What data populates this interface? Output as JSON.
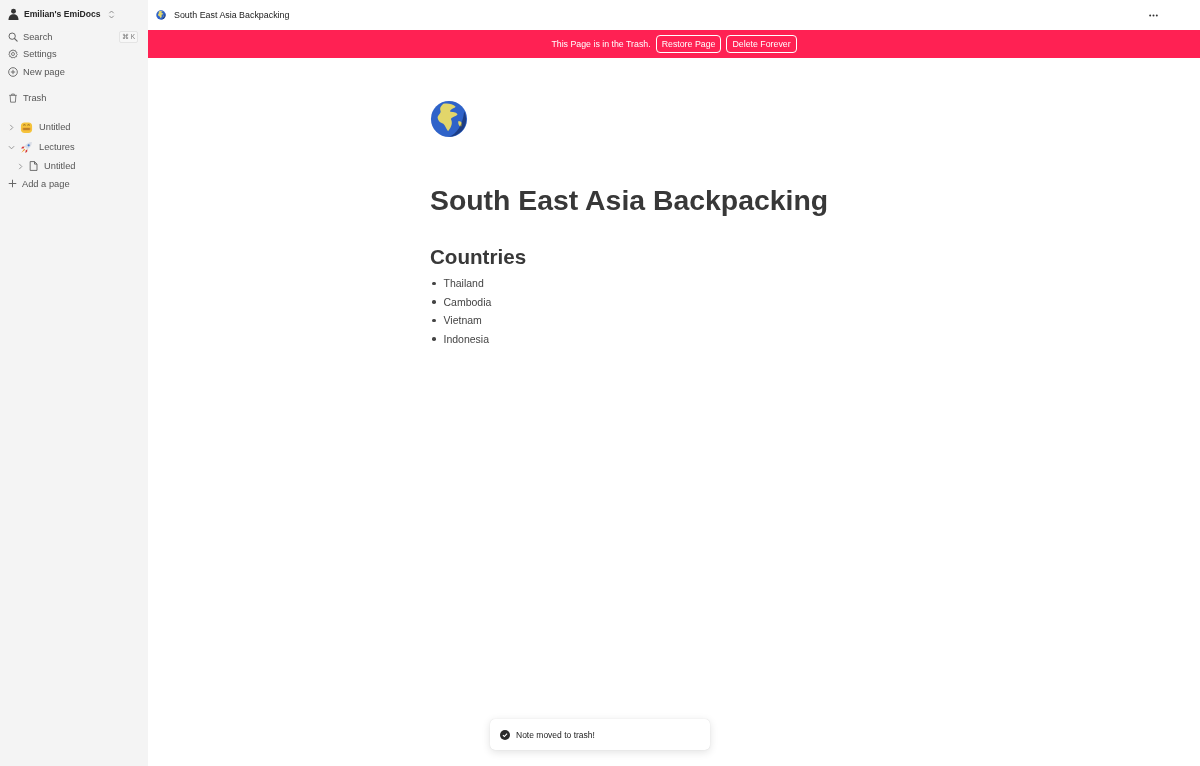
{
  "sidebar": {
    "workspace": {
      "name": "Emilian's EmiDocs"
    },
    "actions": [
      {
        "kind": "search",
        "label": "Search",
        "shortcut": "⌘ K"
      },
      {
        "kind": "settings",
        "label": "Settings"
      },
      {
        "kind": "new-page",
        "label": "New page"
      }
    ],
    "trash": {
      "label": "Trash"
    },
    "pages": [
      {
        "kind": "face",
        "title": "Untitled",
        "expanded": false
      },
      {
        "kind": "rocket",
        "title": "Lectures",
        "expanded": true,
        "children": [
          {
            "kind": "document",
            "title": "Untitled",
            "expanded": false
          }
        ]
      }
    ],
    "add_page": {
      "label": "Add a page"
    }
  },
  "top_bar": {
    "title": "South East Asia Backpacking"
  },
  "trash_banner": {
    "message": "This Page is in the Trash.",
    "buttons": [
      "Restore Page",
      "Delete Forever"
    ]
  },
  "document": {
    "title": "South East Asia Backpacking",
    "sections": [
      {
        "heading": "Countries",
        "items": [
          "Thailand",
          "Cambodia",
          "Vietnam",
          "Indonesia"
        ]
      }
    ]
  },
  "toast": {
    "message": "Note moved to trash!"
  }
}
